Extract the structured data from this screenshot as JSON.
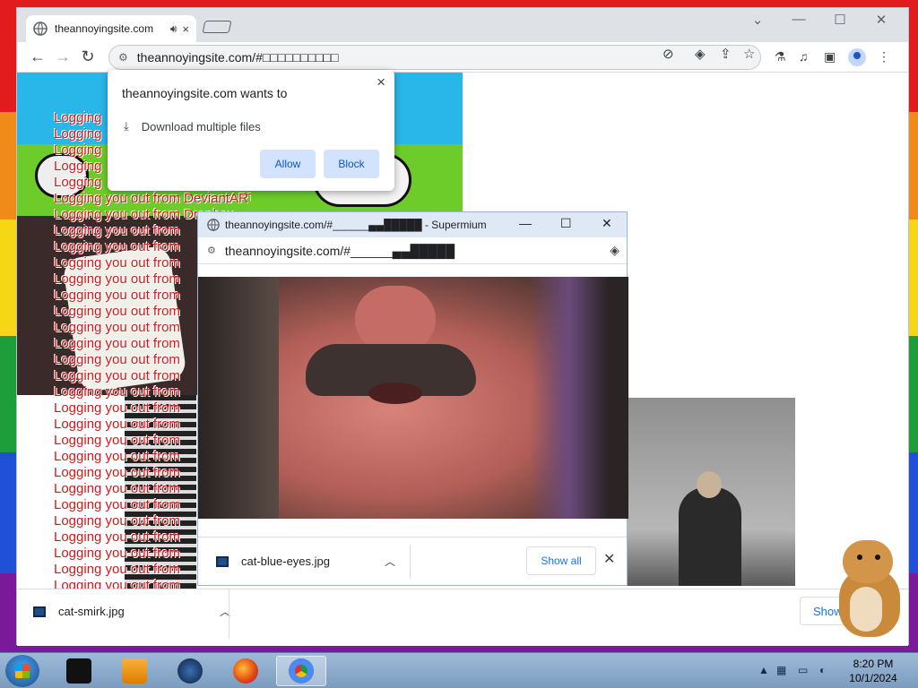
{
  "browser": {
    "tab_title": "theannoyingsite.com",
    "tab_audio_icon": "speaker-icon",
    "tab_close": "×",
    "window_controls": {
      "dropdown": "⌄",
      "minimize": "—",
      "maximize": "☐",
      "close": "✕"
    },
    "address": "theannoyingsite.com/#□□□□□□□□□□",
    "nav": {
      "back": "←",
      "forward": "→",
      "reload": "↻"
    }
  },
  "permission_popup": {
    "title": "theannoyingsite.com wants to",
    "request": "Download multiple files",
    "allow_label": "Allow",
    "block_label": "Block",
    "close": "×"
  },
  "page": {
    "log_lines": [
      "Logging",
      "Logging",
      "Logging",
      "Logging",
      "Logging",
      "Logging you out from DeviantART",
      "Logging you out from Dropbox",
      "Logging you out from",
      "Logging you out from",
      "Logging you out from",
      "Logging you out from",
      "Logging you out from",
      "Logging you out from",
      "Logging you out from",
      "Logging you out from",
      "Logging you out from",
      "Logging you out from",
      "Logging you out from",
      "Logging you out from",
      "Logging you out from",
      "Logging you out from",
      "Logging you out from",
      "Logging you out from",
      "Logging you out from",
      "Logging you out from",
      "Logging you out from",
      "Logging you out from",
      "Logging you out from",
      "Logging you out from",
      "Logging you out from",
      "Logging you out from"
    ]
  },
  "popup_window": {
    "title": "theannoyingsite.com/#______▄▄█████ - Supermium",
    "address": "theannoyingsite.com/#______▄▄█████",
    "download_file": "cat-blue-eyes.jpg",
    "show_all": "Show all",
    "controls": {
      "minimize": "—",
      "maximize": "☐",
      "close": "✕"
    }
  },
  "main_download_bar": {
    "file": "cat-smirk.jpg",
    "show_all": "Show"
  },
  "taskbar": {
    "time": "8:20 PM",
    "date": "10/1/2024",
    "tray_arrow": "▲"
  }
}
